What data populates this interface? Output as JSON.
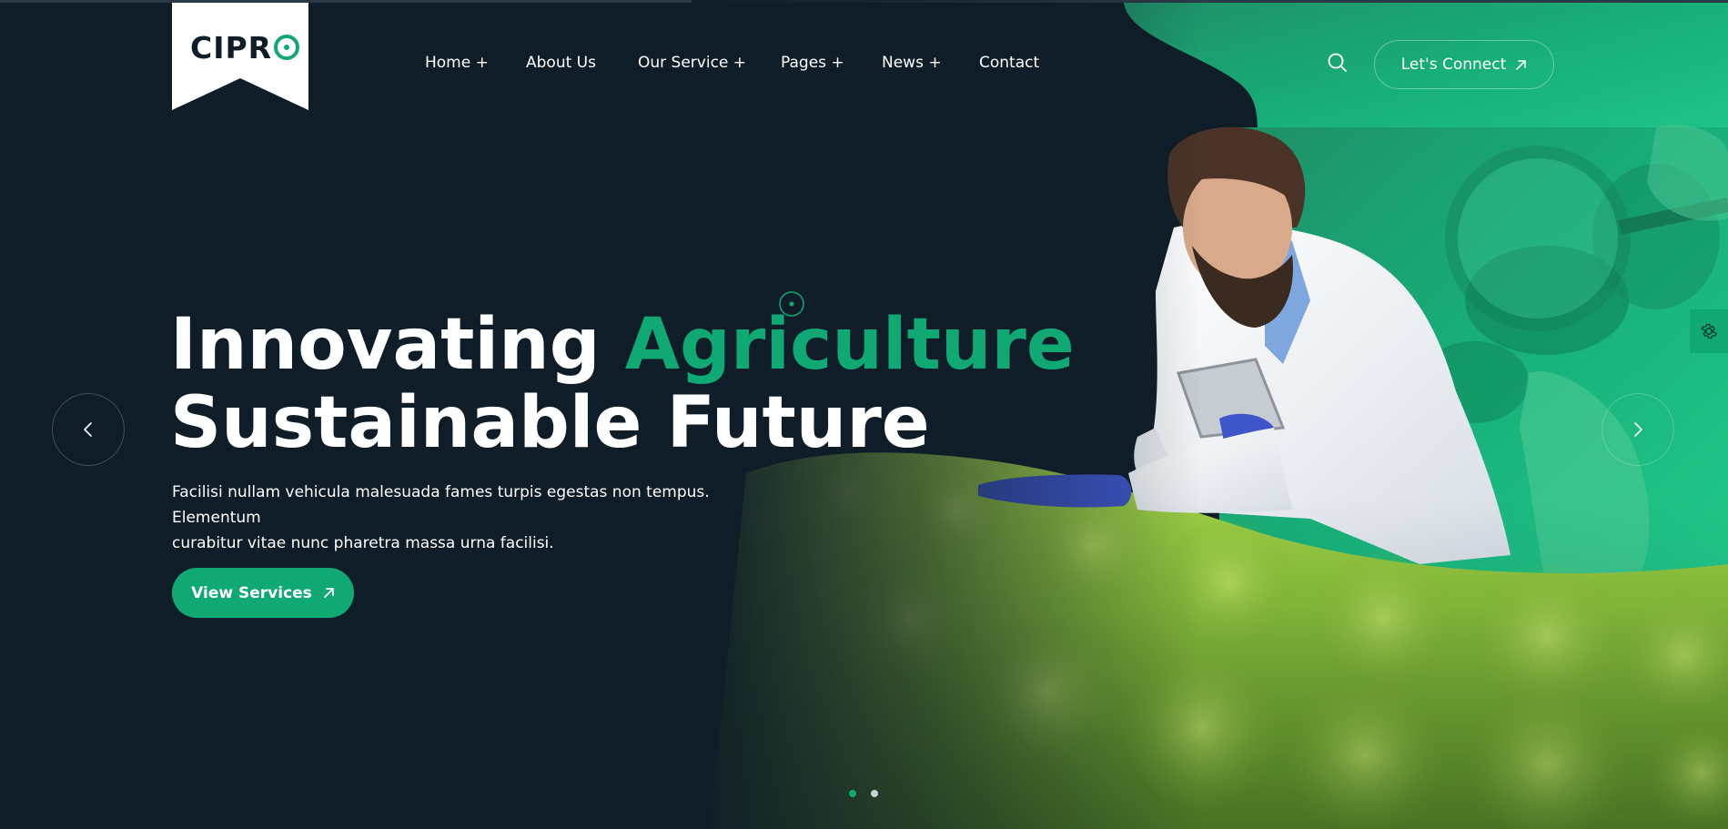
{
  "brand": {
    "logo_text": "CIPR",
    "accent_color": "#10a873",
    "bg_color": "#0e1d28"
  },
  "nav": {
    "items": [
      {
        "label": "Home +"
      },
      {
        "label": "About Us"
      },
      {
        "label": "Our Service +"
      },
      {
        "label": "Pages +"
      },
      {
        "label": "News +"
      },
      {
        "label": "Contact"
      }
    ]
  },
  "header": {
    "search_icon": "search-icon",
    "cta_label": "Let's Connect",
    "cta_icon": "arrow-up-right-icon"
  },
  "hero": {
    "title_line1_part1": "Innovating ",
    "title_line1_accent": "Agriculture",
    "title_line2": "Sustainable Future",
    "description_line1": "Facilisi nullam vehicula malesuada fames turpis egestas non tempus. Elementum",
    "description_line2": "curabitur vitae nunc pharetra massa urna facilisi.",
    "button_label": "View Services",
    "button_icon": "arrow-up-right-icon"
  },
  "slider": {
    "prev_icon": "chevron-left-icon",
    "next_icon": "chevron-right-icon",
    "total_slides": 2,
    "active_slide": 1
  },
  "settings": {
    "icon": "gear-icon"
  }
}
